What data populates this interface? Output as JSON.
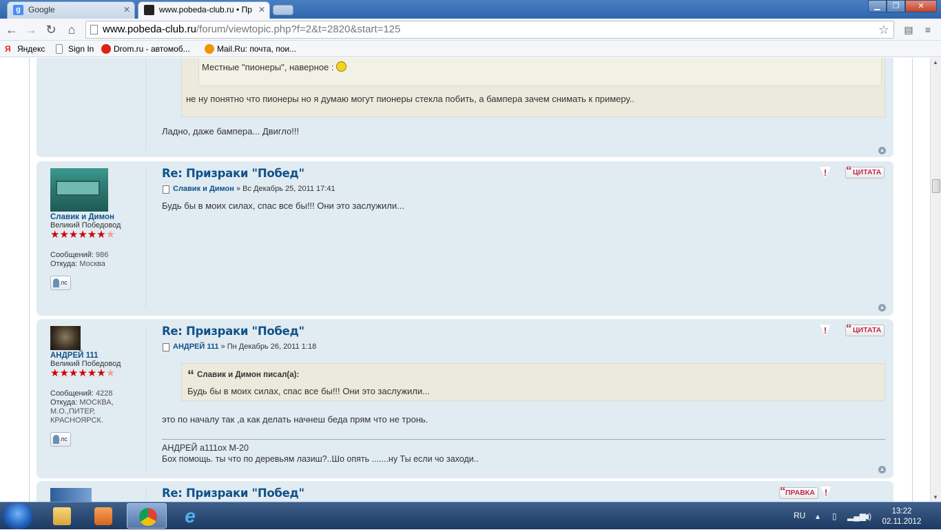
{
  "browser": {
    "tabs": [
      {
        "label": "Google"
      },
      {
        "label": "www.pobeda-club.ru • Пр"
      }
    ],
    "url_host": "www.pobeda-club.ru",
    "url_path": "/forum/viewtopic.php?f=2&t=2820&start=125",
    "bookmarks": [
      {
        "label": "Яндекс"
      },
      {
        "label": "Sign In"
      },
      {
        "label": "Drom.ru - автомоб..."
      },
      {
        "label": "Mail.Ru: почта, пои..."
      }
    ]
  },
  "posts": {
    "prev": {
      "inner_quote_text": "Местные \"пионеры\", наверное :",
      "quote_text": "не ну понятно что пионеры но я думаю могут пионеры стекла побить, а бампера зачем снимать к примеру..",
      "body": "Ладно, даже бампера... Двигло!!!"
    },
    "post1": {
      "title": "Re: Призраки \"Побед\"",
      "author": "Славик и Димон",
      "date": "» Вс Декабрь 25, 2011 17:41",
      "body": "Будь бы в моих силах, спас все бы!!! Они это заслужили...",
      "profile": {
        "name": "Славик и Димон",
        "rank": "Великий Победовод",
        "posts_label": "Сообщений:",
        "posts": "986",
        "from_label": "Откуда:",
        "from": "Москва",
        "pm": "лс"
      },
      "quote_button": "ЦИТАТА"
    },
    "post2": {
      "title": "Re: Призраки \"Побед\"",
      "author": "АНДРЕЙ 111",
      "date": "» Пн Декабрь 26, 2011 1:18",
      "quote_header": "Славик и Димон писал(а):",
      "quote_text": "Будь бы в моих силах, спас все бы!!! Они это заслужили...",
      "body": "это по началу так ,а как делать начнеш беда прям что не тронь.",
      "signature_line1": "АНДРЕЙ а111ох М-20",
      "signature_line2": "Бох помощь. ты что по деревьям лазиш?..Шо опять .......ну Ты если чо заходи..",
      "profile": {
        "name": "АНДРЕЙ 111",
        "rank": "Великий Победовод",
        "posts_label": "Сообщений:",
        "posts": "4228",
        "from_label": "Откуда:",
        "from": "МОСКВА, М.О.,ПИТЕР, КРАСНОЯРСК.",
        "pm": "лс"
      },
      "quote_button": "ЦИТАТА"
    },
    "post3": {
      "title": "Re: Призраки \"Побед\"",
      "edit_button": "ПРАВКА"
    }
  },
  "rating": {
    "filled": 6,
    "total": 7
  },
  "taskbar": {
    "lang": "RU",
    "time": "13:22",
    "date": "02.11.2012"
  },
  "colors": {
    "post_bg": "#e1ebf2",
    "link": "#105289",
    "quote_bg": "#ebeadd",
    "button_red": "#bc2a4d"
  }
}
